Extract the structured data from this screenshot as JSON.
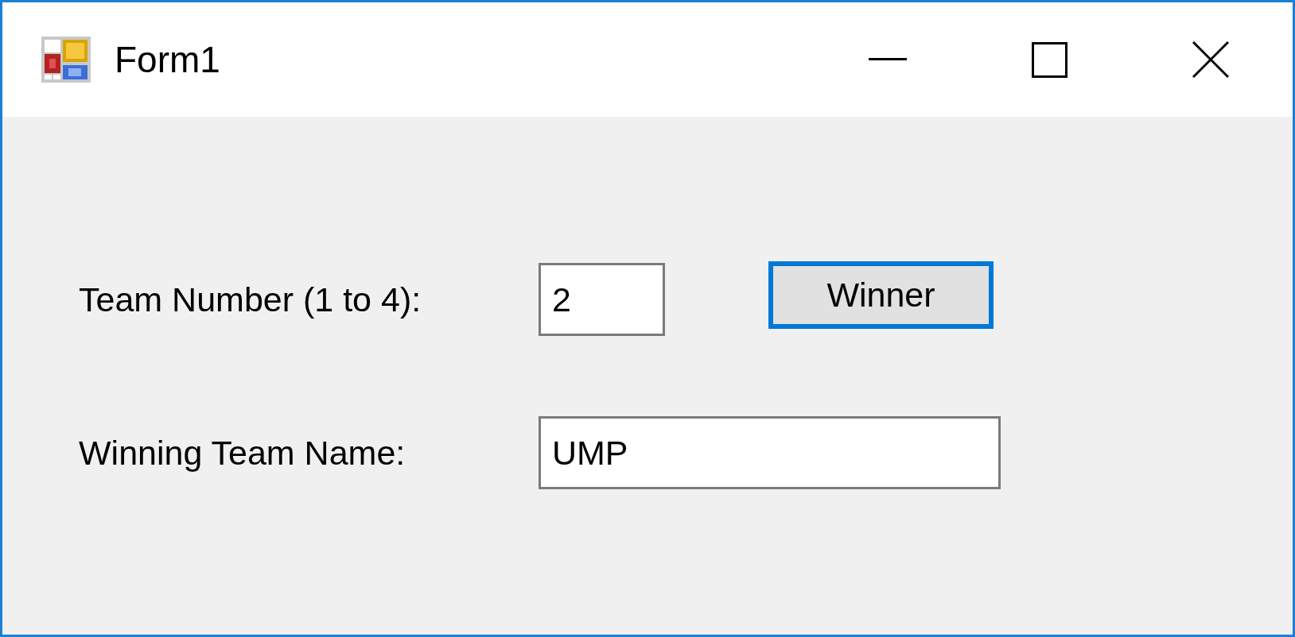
{
  "window": {
    "title": "Form1"
  },
  "fields": [
    {
      "label": "Team Number (1 to 4):",
      "value": "2",
      "kind": "short"
    },
    {
      "label": "Winning Team Name:",
      "value": "UMP",
      "kind": "long"
    }
  ],
  "button": {
    "label": "Winner",
    "focused": true
  }
}
